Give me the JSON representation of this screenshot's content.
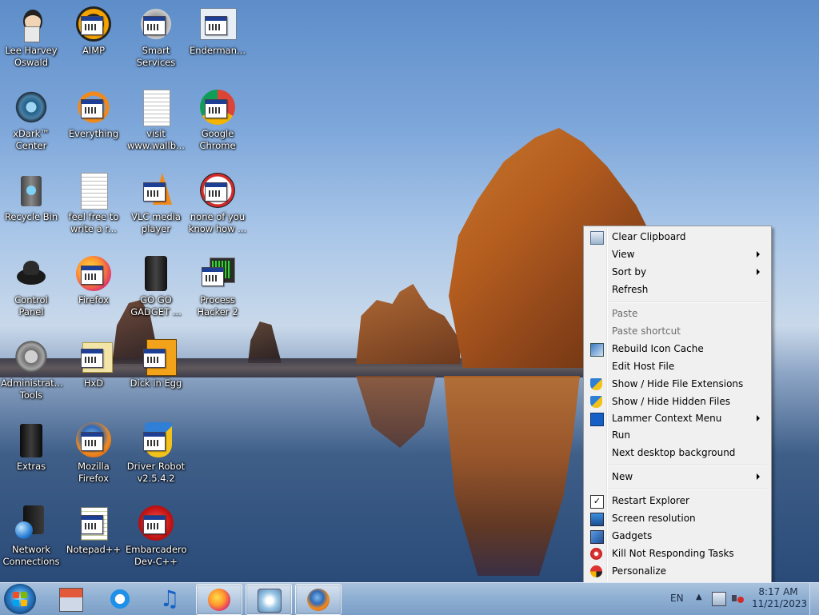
{
  "desktop": {
    "icons": [
      {
        "label": "Lee Harvey\nOswald",
        "icon": "doll-icon"
      },
      {
        "label": "AIMP",
        "icon": "aimp-icon"
      },
      {
        "label": "Smart\nServices",
        "icon": "gears-icon"
      },
      {
        "label": "Enderman...",
        "icon": "window-icon"
      },
      {
        "label": "xDark™\nCenter",
        "icon": "gear-ring-icon"
      },
      {
        "label": "Everything",
        "icon": "search-icon"
      },
      {
        "label": "visit\nwww.wallb...",
        "icon": "text-document-icon"
      },
      {
        "label": "Google\nChrome",
        "icon": "chrome-icon"
      },
      {
        "label": "Recycle Bin",
        "icon": "recycle-bin-icon"
      },
      {
        "label": "feel free to\nwrite a r...",
        "icon": "text-document-icon"
      },
      {
        "label": "VLC media\nplayer",
        "icon": "vlc-cone-icon"
      },
      {
        "label": "none of you\nknow how ...",
        "icon": "app-icon"
      },
      {
        "label": "Control Panel",
        "icon": "control-panel-icon"
      },
      {
        "label": "Firefox",
        "icon": "firefox-icon"
      },
      {
        "label": "GO GO\nGADGET ...",
        "icon": "gadget-icon"
      },
      {
        "label": "Process\nHacker 2",
        "icon": "process-hacker-icon"
      },
      {
        "label": "Administrat...\nTools",
        "icon": "admin-tools-icon"
      },
      {
        "label": "HxD",
        "icon": "hxd-icon"
      },
      {
        "label": "Dick in Egg",
        "icon": "egg-app-icon"
      },
      {
        "label": "Extras",
        "icon": "folder-icon"
      },
      {
        "label": "Mozilla\nFirefox",
        "icon": "firefox-icon"
      },
      {
        "label": "Driver Robot\nv2.5.4.2",
        "icon": "shield-icon"
      },
      {
        "label": "Network\nConnections",
        "icon": "network-icon"
      },
      {
        "label": "Notepad++",
        "icon": "notepad-icon"
      },
      {
        "label": "Embarcadero\nDev-C++",
        "icon": "devcpp-icon"
      }
    ]
  },
  "context_menu": {
    "items": [
      {
        "label": "Clear Clipboard",
        "icon": "clipboard-icon",
        "submenu": false,
        "disabled": false
      },
      {
        "label": "View",
        "submenu": true,
        "disabled": false
      },
      {
        "label": "Sort by",
        "submenu": true,
        "disabled": false
      },
      {
        "label": "Refresh",
        "submenu": false,
        "disabled": false
      },
      {
        "label": "Paste",
        "submenu": false,
        "disabled": true
      },
      {
        "label": "Paste shortcut",
        "submenu": false,
        "disabled": true
      },
      {
        "label": "Rebuild Icon Cache",
        "icon": "rebuild-icon",
        "submenu": false,
        "disabled": false
      },
      {
        "label": "Edit Host File",
        "submenu": false,
        "disabled": false
      },
      {
        "label": "Show / Hide File Extensions",
        "icon": "shield-icon",
        "submenu": false,
        "disabled": false
      },
      {
        "label": "Show / Hide Hidden Files",
        "icon": "shield-icon",
        "submenu": false,
        "disabled": false
      },
      {
        "label": "Lammer Context Menu",
        "icon": "lammer-icon",
        "submenu": true,
        "disabled": false
      },
      {
        "label": "Run",
        "submenu": false,
        "disabled": false
      },
      {
        "label": "Next desktop background",
        "submenu": false,
        "disabled": false
      },
      {
        "label": "New",
        "submenu": true,
        "disabled": false
      },
      {
        "label": "Restart Explorer",
        "icon": "checkmark-icon",
        "submenu": false,
        "disabled": false
      },
      {
        "label": "Screen resolution",
        "icon": "monitor-icon",
        "submenu": false,
        "disabled": false
      },
      {
        "label": "Gadgets",
        "icon": "gadgets-icon",
        "submenu": false,
        "disabled": false
      },
      {
        "label": "Kill Not Responding Tasks",
        "icon": "kill-icon",
        "submenu": false,
        "disabled": false
      },
      {
        "label": "Personalize",
        "icon": "personalize-icon",
        "submenu": false,
        "disabled": false
      }
    ]
  },
  "taskbar": {
    "pinned": [
      {
        "name": "store-icon"
      },
      {
        "name": "internet-explorer-icon"
      },
      {
        "name": "music-note-icon"
      },
      {
        "name": "firefox-icon",
        "active": true
      },
      {
        "name": "media-center-icon",
        "active": true
      },
      {
        "name": "firefox-icon",
        "active": true
      }
    ],
    "tray": {
      "language": "EN",
      "time": "8:17 AM",
      "date": "11/21/2023"
    }
  },
  "colors": {
    "taskbar": "#8fb0d3",
    "menu_background": "#f0f0f0",
    "menu_disabled_text": "#6d6d6d"
  }
}
